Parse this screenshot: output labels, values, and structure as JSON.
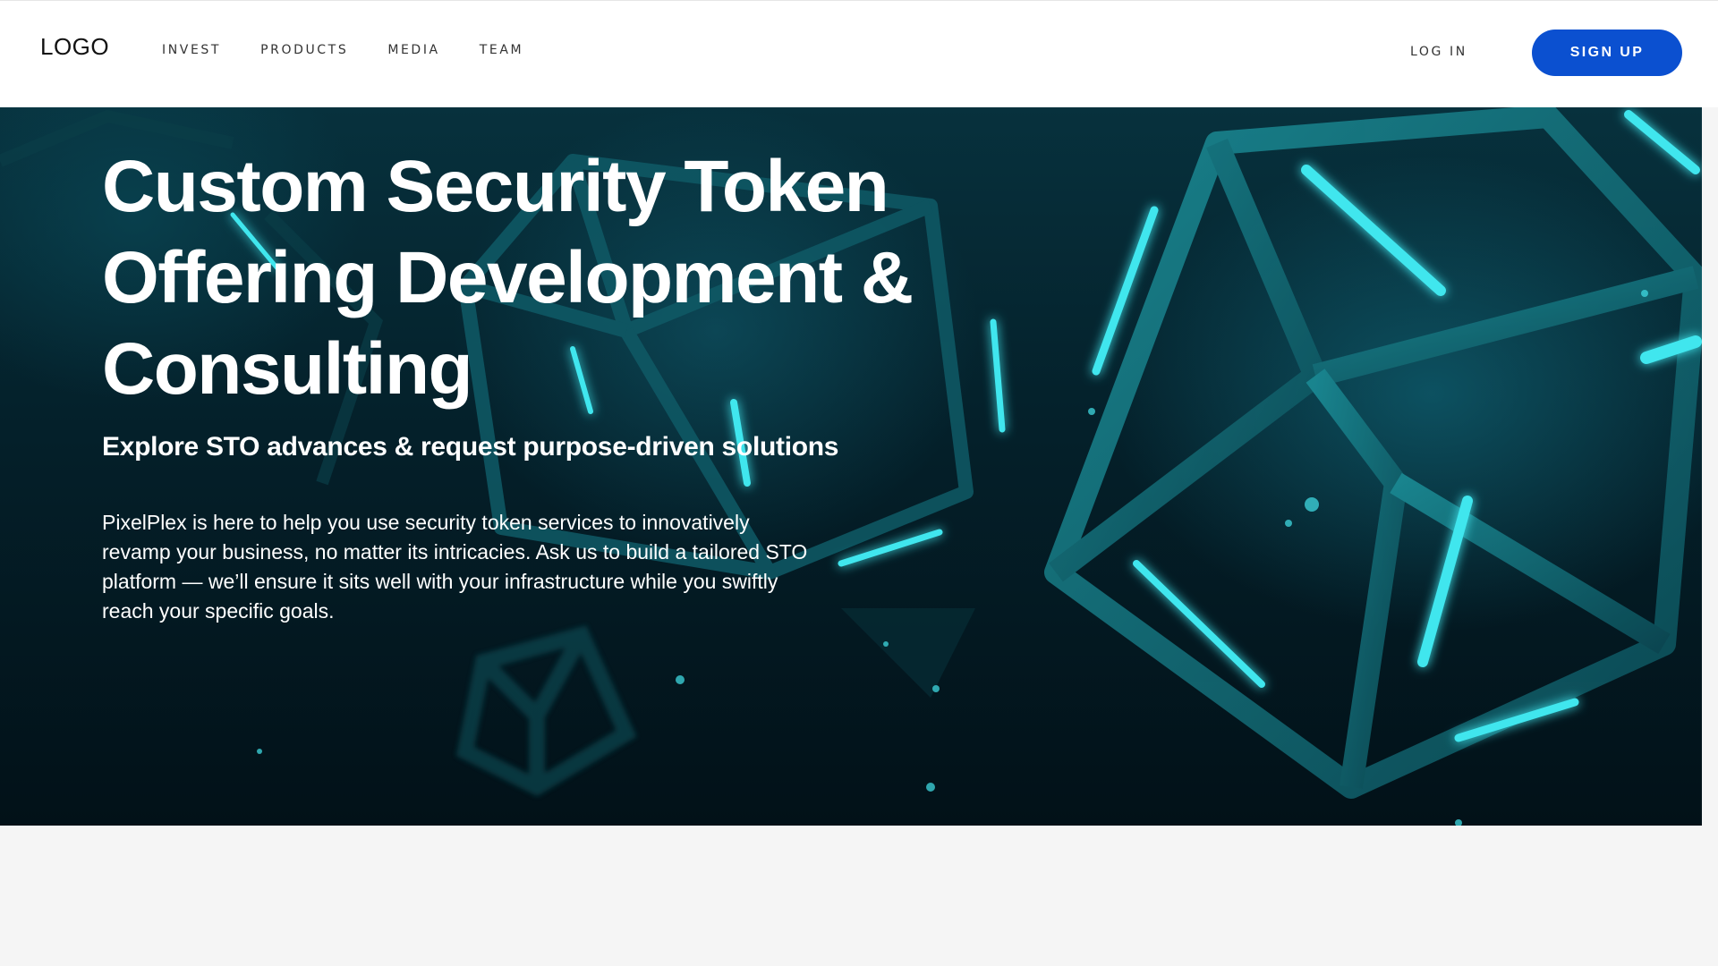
{
  "header": {
    "logo": "LOGO",
    "nav": [
      {
        "label": "INVEST"
      },
      {
        "label": "PRODUCTS"
      },
      {
        "label": "MEDIA"
      },
      {
        "label": "TEAM"
      }
    ],
    "login_label": "LOG IN",
    "signup_label": "SIGN UP"
  },
  "hero": {
    "title_lines": [
      "Custom Security Token",
      "Offering Development &",
      "Consulting"
    ],
    "subtitle": "Explore STO advances & request purpose-driven solutions",
    "body_lines": [
      "PixelPlex is here to help you use security token services to innovatively",
      "revamp your business, no matter its intricacies. Ask us to build a tailored STO",
      "platform — we’ll ensure it sits well with your infrastructure while you swiftly",
      "reach your specific goals."
    ]
  },
  "colors": {
    "accent": "#0b50d0",
    "hero_bg": "#04202a",
    "neon": "#2fe0e8",
    "page_bg": "#f5f5f5"
  }
}
